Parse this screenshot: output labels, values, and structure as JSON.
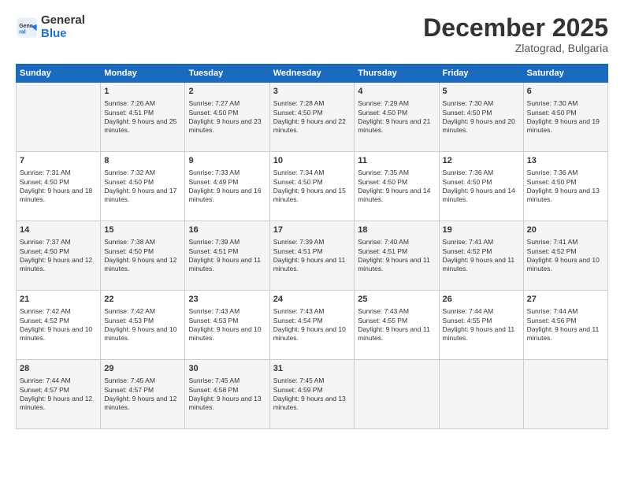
{
  "logo": {
    "line1": "General",
    "line2": "Blue"
  },
  "title": "December 2025",
  "subtitle": "Zlatograd, Bulgaria",
  "weekdays": [
    "Sunday",
    "Monday",
    "Tuesday",
    "Wednesday",
    "Thursday",
    "Friday",
    "Saturday"
  ],
  "weeks": [
    [
      {
        "day": "",
        "sunrise": "",
        "sunset": "",
        "daylight": ""
      },
      {
        "day": "1",
        "sunrise": "Sunrise: 7:26 AM",
        "sunset": "Sunset: 4:51 PM",
        "daylight": "Daylight: 9 hours and 25 minutes."
      },
      {
        "day": "2",
        "sunrise": "Sunrise: 7:27 AM",
        "sunset": "Sunset: 4:50 PM",
        "daylight": "Daylight: 9 hours and 23 minutes."
      },
      {
        "day": "3",
        "sunrise": "Sunrise: 7:28 AM",
        "sunset": "Sunset: 4:50 PM",
        "daylight": "Daylight: 9 hours and 22 minutes."
      },
      {
        "day": "4",
        "sunrise": "Sunrise: 7:29 AM",
        "sunset": "Sunset: 4:50 PM",
        "daylight": "Daylight: 9 hours and 21 minutes."
      },
      {
        "day": "5",
        "sunrise": "Sunrise: 7:30 AM",
        "sunset": "Sunset: 4:50 PM",
        "daylight": "Daylight: 9 hours and 20 minutes."
      },
      {
        "day": "6",
        "sunrise": "Sunrise: 7:30 AM",
        "sunset": "Sunset: 4:50 PM",
        "daylight": "Daylight: 9 hours and 19 minutes."
      }
    ],
    [
      {
        "day": "7",
        "sunrise": "Sunrise: 7:31 AM",
        "sunset": "Sunset: 4:50 PM",
        "daylight": "Daylight: 9 hours and 18 minutes."
      },
      {
        "day": "8",
        "sunrise": "Sunrise: 7:32 AM",
        "sunset": "Sunset: 4:50 PM",
        "daylight": "Daylight: 9 hours and 17 minutes."
      },
      {
        "day": "9",
        "sunrise": "Sunrise: 7:33 AM",
        "sunset": "Sunset: 4:49 PM",
        "daylight": "Daylight: 9 hours and 16 minutes."
      },
      {
        "day": "10",
        "sunrise": "Sunrise: 7:34 AM",
        "sunset": "Sunset: 4:50 PM",
        "daylight": "Daylight: 9 hours and 15 minutes."
      },
      {
        "day": "11",
        "sunrise": "Sunrise: 7:35 AM",
        "sunset": "Sunset: 4:50 PM",
        "daylight": "Daylight: 9 hours and 14 minutes."
      },
      {
        "day": "12",
        "sunrise": "Sunrise: 7:36 AM",
        "sunset": "Sunset: 4:50 PM",
        "daylight": "Daylight: 9 hours and 14 minutes."
      },
      {
        "day": "13",
        "sunrise": "Sunrise: 7:36 AM",
        "sunset": "Sunset: 4:50 PM",
        "daylight": "Daylight: 9 hours and 13 minutes."
      }
    ],
    [
      {
        "day": "14",
        "sunrise": "Sunrise: 7:37 AM",
        "sunset": "Sunset: 4:50 PM",
        "daylight": "Daylight: 9 hours and 12 minutes."
      },
      {
        "day": "15",
        "sunrise": "Sunrise: 7:38 AM",
        "sunset": "Sunset: 4:50 PM",
        "daylight": "Daylight: 9 hours and 12 minutes."
      },
      {
        "day": "16",
        "sunrise": "Sunrise: 7:39 AM",
        "sunset": "Sunset: 4:51 PM",
        "daylight": "Daylight: 9 hours and 11 minutes."
      },
      {
        "day": "17",
        "sunrise": "Sunrise: 7:39 AM",
        "sunset": "Sunset: 4:51 PM",
        "daylight": "Daylight: 9 hours and 11 minutes."
      },
      {
        "day": "18",
        "sunrise": "Sunrise: 7:40 AM",
        "sunset": "Sunset: 4:51 PM",
        "daylight": "Daylight: 9 hours and 11 minutes."
      },
      {
        "day": "19",
        "sunrise": "Sunrise: 7:41 AM",
        "sunset": "Sunset: 4:52 PM",
        "daylight": "Daylight: 9 hours and 11 minutes."
      },
      {
        "day": "20",
        "sunrise": "Sunrise: 7:41 AM",
        "sunset": "Sunset: 4:52 PM",
        "daylight": "Daylight: 9 hours and 10 minutes."
      }
    ],
    [
      {
        "day": "21",
        "sunrise": "Sunrise: 7:42 AM",
        "sunset": "Sunset: 4:52 PM",
        "daylight": "Daylight: 9 hours and 10 minutes."
      },
      {
        "day": "22",
        "sunrise": "Sunrise: 7:42 AM",
        "sunset": "Sunset: 4:53 PM",
        "daylight": "Daylight: 9 hours and 10 minutes."
      },
      {
        "day": "23",
        "sunrise": "Sunrise: 7:43 AM",
        "sunset": "Sunset: 4:53 PM",
        "daylight": "Daylight: 9 hours and 10 minutes."
      },
      {
        "day": "24",
        "sunrise": "Sunrise: 7:43 AM",
        "sunset": "Sunset: 4:54 PM",
        "daylight": "Daylight: 9 hours and 10 minutes."
      },
      {
        "day": "25",
        "sunrise": "Sunrise: 7:43 AM",
        "sunset": "Sunset: 4:55 PM",
        "daylight": "Daylight: 9 hours and 11 minutes."
      },
      {
        "day": "26",
        "sunrise": "Sunrise: 7:44 AM",
        "sunset": "Sunset: 4:55 PM",
        "daylight": "Daylight: 9 hours and 11 minutes."
      },
      {
        "day": "27",
        "sunrise": "Sunrise: 7:44 AM",
        "sunset": "Sunset: 4:56 PM",
        "daylight": "Daylight: 9 hours and 11 minutes."
      }
    ],
    [
      {
        "day": "28",
        "sunrise": "Sunrise: 7:44 AM",
        "sunset": "Sunset: 4:57 PM",
        "daylight": "Daylight: 9 hours and 12 minutes."
      },
      {
        "day": "29",
        "sunrise": "Sunrise: 7:45 AM",
        "sunset": "Sunset: 4:57 PM",
        "daylight": "Daylight: 9 hours and 12 minutes."
      },
      {
        "day": "30",
        "sunrise": "Sunrise: 7:45 AM",
        "sunset": "Sunset: 4:58 PM",
        "daylight": "Daylight: 9 hours and 13 minutes."
      },
      {
        "day": "31",
        "sunrise": "Sunrise: 7:45 AM",
        "sunset": "Sunset: 4:59 PM",
        "daylight": "Daylight: 9 hours and 13 minutes."
      },
      {
        "day": "",
        "sunrise": "",
        "sunset": "",
        "daylight": ""
      },
      {
        "day": "",
        "sunrise": "",
        "sunset": "",
        "daylight": ""
      },
      {
        "day": "",
        "sunrise": "",
        "sunset": "",
        "daylight": ""
      }
    ]
  ]
}
